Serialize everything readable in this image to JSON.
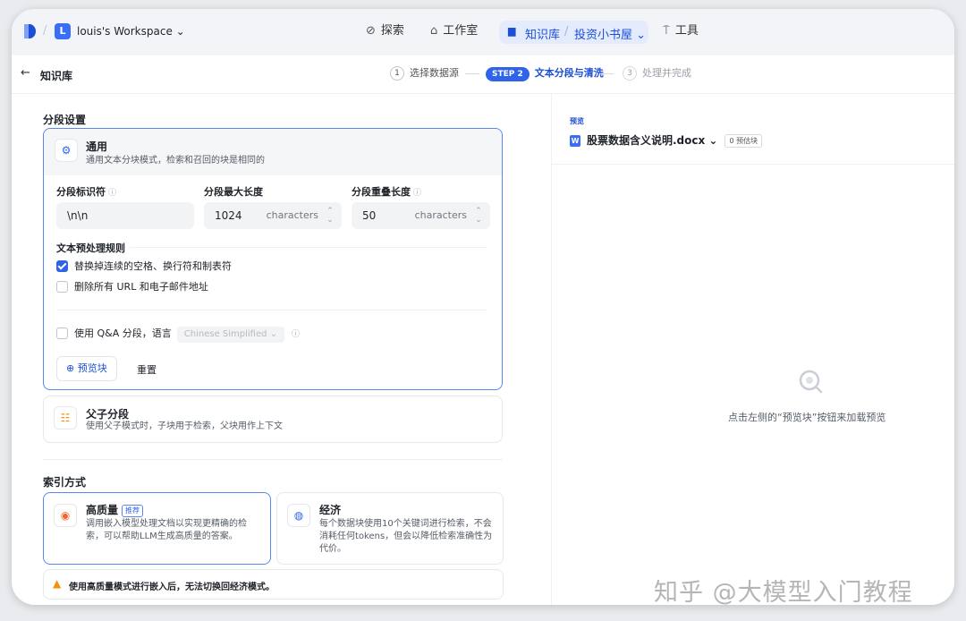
{
  "topbar": {
    "workspace_initial": "L",
    "workspace_name": "louis's Workspace ⌄",
    "nav_explore": "探索",
    "nav_studio": "工作室",
    "nav_knowledge": "知识库",
    "nav_dataset": "投资小书屋 ⌄",
    "nav_tools": "工具"
  },
  "subbar": {
    "title": "知识库",
    "step1_num": "1",
    "step1_label": "选择数据源",
    "step2_pill": "STEP 2",
    "step2_label": "文本分段与清洗",
    "step3_num": "3",
    "step3_label": "处理并完成"
  },
  "segment": {
    "section_title": "分段设置",
    "general_title": "通用",
    "general_desc": "通用文本分块模式，检索和召回的块是相同的",
    "identifier_label": "分段标识符",
    "identifier_value": "\\n\\n",
    "max_len_label": "分段最大长度",
    "max_len_value": "1024",
    "max_len_unit": "characters",
    "overlap_label": "分段重叠长度",
    "overlap_value": "50",
    "overlap_unit": "characters",
    "rules_title": "文本预处理规则",
    "rule1": "替换掉连续的空格、换行符和制表符",
    "rule2": "删除所有 URL 和电子邮件地址",
    "qa_label": "使用 Q&A 分段，语言",
    "qa_lang": "Chinese Simplified ⌄",
    "preview_button": "预览块",
    "reset_button": "重置",
    "parent_title": "父子分段",
    "parent_desc": "使用父子模式时，子块用于检索，父块用作上下文"
  },
  "index": {
    "section_title": "索引方式",
    "hq_title": "高质量",
    "hq_tag": "推荐",
    "hq_desc1": "调用嵌入模型处理文档以实现更精确的检",
    "hq_desc2": "索，可以帮助LLM生成高质量的答案。",
    "eco_title": "经济",
    "eco_desc1": "每个数据块使用10个关键词进行检索，不会",
    "eco_desc2": "消耗任何tokens，但会以降低检索准确性为",
    "eco_desc3": "代价。",
    "warning": "使用高质量模式进行嵌入后，无法切换回经济模式。"
  },
  "preview": {
    "label": "预览",
    "file_name": "股票数据含义说明.docx ⌄",
    "chunk_count": "0 预估块",
    "empty_text": "点击左侧的“预览块”按钮来加载预览"
  },
  "watermark": "知乎 @大模型入门教程",
  "colors": {
    "accent": "#2f63ea",
    "selected_border": "#5a86f0",
    "warning": "#f79009"
  }
}
